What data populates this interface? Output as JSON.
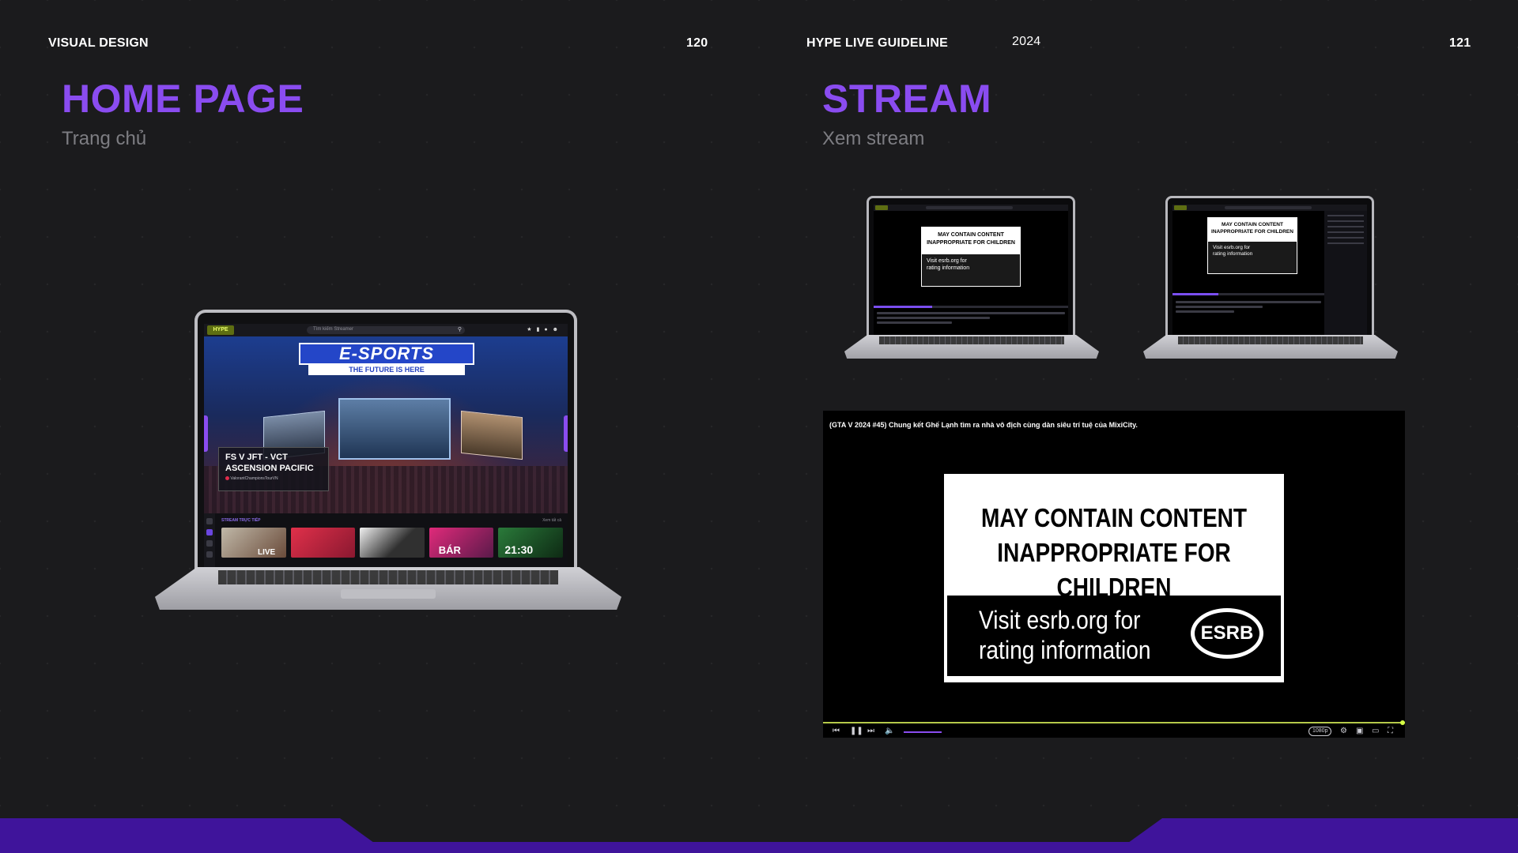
{
  "header": {
    "left_label": "VISUAL DESIGN",
    "left_page": "120",
    "center_label": "HYPE LIVE GUIDELINE",
    "year": "2024",
    "right_page": "121"
  },
  "home": {
    "title": "HOME PAGE",
    "subtitle": "Trang chủ"
  },
  "stream": {
    "title": "STREAM",
    "subtitle": "Xem stream"
  },
  "home_mock": {
    "logo": "HYPE LIVE",
    "search_placeholder": "Tìm kiếm Streamer",
    "banner_title": "E-SPORTS",
    "banner_sub": "THE FUTURE IS HERE",
    "card_title": "FS V JFT - VCT ASCENSION PACIFIC",
    "card_meta": "ValorantChampionsTourVN",
    "section_label": "STREAM TRỰC TIẾP",
    "view_all": "Xem tất cả",
    "thumb_live": "LIVE",
    "thumb_bar": "BÁR",
    "thumb_time": "21:30"
  },
  "esrb": {
    "line1": "MAY CONTAIN CONTENT",
    "line2": "INAPPROPRIATE FOR CHILDREN",
    "visit1": "Visit esrb.org for",
    "visit2": "rating information",
    "logo": "ESRB"
  },
  "player": {
    "video_title": "(GTA V 2024 #45) Chung kết Ghế Lạnh tìm ra nhà vô địch cùng dàn siêu trí tuệ của MixiCity.",
    "quality": "1080p",
    "icons": [
      "skip-back-icon",
      "pause-icon",
      "skip-forward-icon",
      "volume-icon",
      "gear-icon",
      "pip-icon",
      "theater-icon",
      "fullscreen-icon"
    ]
  },
  "colors": {
    "accent": "#8a4cf0",
    "band": "#3f149b",
    "background": "#1b1b1d",
    "progress": "#b5c94a"
  }
}
